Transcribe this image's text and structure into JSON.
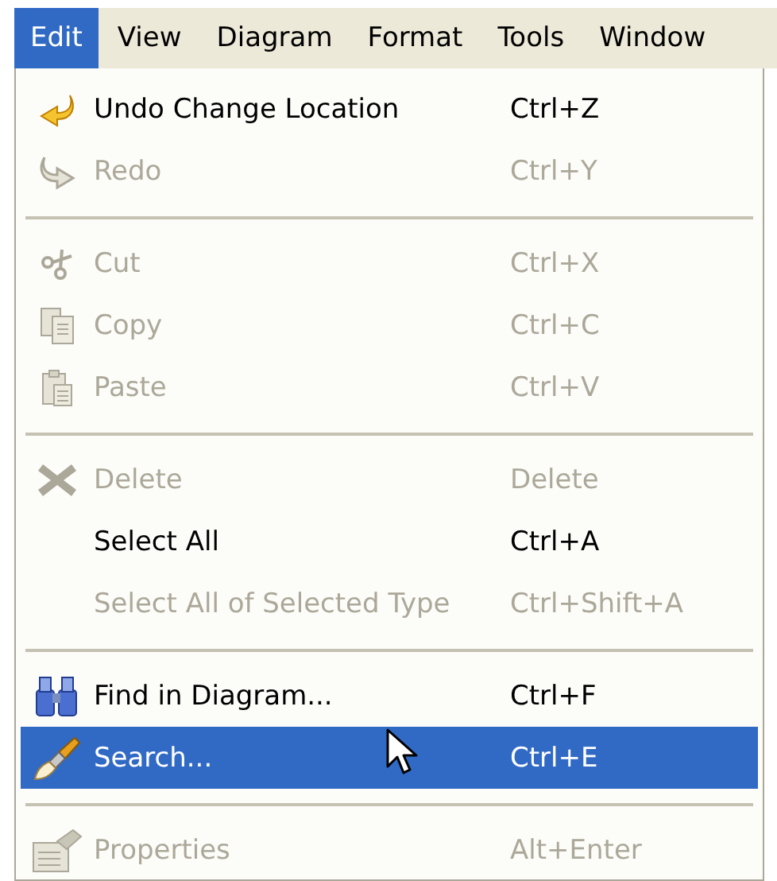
{
  "menubar": [
    {
      "label": "Edit",
      "selected": true
    },
    {
      "label": "View",
      "selected": false
    },
    {
      "label": "Diagram",
      "selected": false
    },
    {
      "label": "Format",
      "selected": false
    },
    {
      "label": "Tools",
      "selected": false
    },
    {
      "label": "Window",
      "selected": false
    }
  ],
  "menu": {
    "items": [
      {
        "kind": "item",
        "label": "Undo Change Location",
        "shortcut": "Ctrl+Z",
        "disabled": false,
        "selected": false
      },
      {
        "kind": "item",
        "label": "Redo",
        "shortcut": "Ctrl+Y",
        "disabled": true,
        "selected": false
      },
      {
        "kind": "separator"
      },
      {
        "kind": "item",
        "label": "Cut",
        "shortcut": "Ctrl+X",
        "disabled": true,
        "selected": false
      },
      {
        "kind": "item",
        "label": "Copy",
        "shortcut": "Ctrl+C",
        "disabled": true,
        "selected": false
      },
      {
        "kind": "item",
        "label": "Paste",
        "shortcut": "Ctrl+V",
        "disabled": true,
        "selected": false
      },
      {
        "kind": "separator"
      },
      {
        "kind": "item",
        "label": "Delete",
        "shortcut": "Delete",
        "disabled": true,
        "selected": false
      },
      {
        "kind": "item",
        "label": "Select All",
        "shortcut": "Ctrl+A",
        "disabled": false,
        "selected": false
      },
      {
        "kind": "item",
        "label": "Select All of Selected Type",
        "shortcut": "Ctrl+Shift+A",
        "disabled": true,
        "selected": false
      },
      {
        "kind": "separator"
      },
      {
        "kind": "item",
        "label": "Find in Diagram...",
        "shortcut": "Ctrl+F",
        "disabled": false,
        "selected": false
      },
      {
        "kind": "item",
        "label": "Search...",
        "shortcut": "Ctrl+E",
        "disabled": false,
        "selected": true
      },
      {
        "kind": "separator"
      },
      {
        "kind": "item",
        "label": "Properties",
        "shortcut": "Alt+Enter",
        "disabled": true,
        "selected": false
      }
    ]
  }
}
